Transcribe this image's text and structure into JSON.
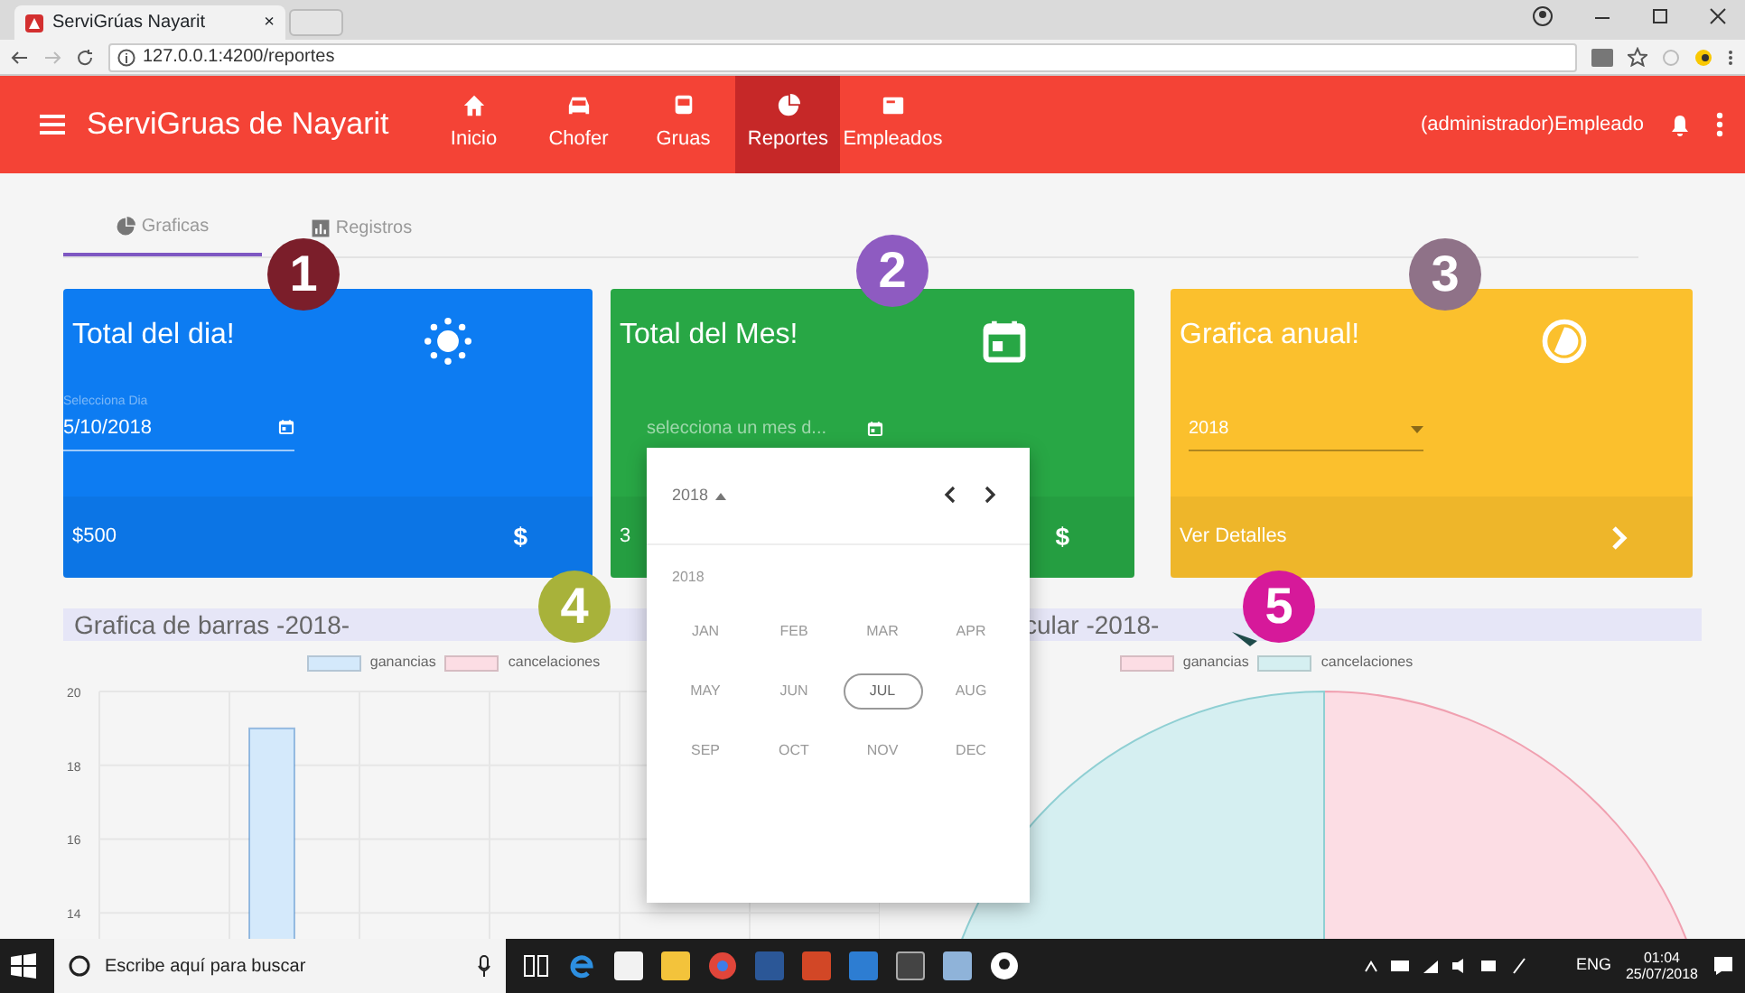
{
  "browser": {
    "tab_title": "ServiGrúas Nayarit",
    "tab_close": "×",
    "url": "127.0.0.1:4200/reportes"
  },
  "navbar": {
    "brand": "ServiGruas de Nayarit",
    "items": [
      {
        "label": "Inicio",
        "selected": false
      },
      {
        "label": "Chofer",
        "selected": false
      },
      {
        "label": "Gruas",
        "selected": false
      },
      {
        "label": "Reportes",
        "selected": true
      },
      {
        "label": "Empleados",
        "selected": false
      }
    ],
    "user": "(administrador)Empleado"
  },
  "tabs": [
    {
      "label": "Graficas",
      "selected": true
    },
    {
      "label": "Registros",
      "selected": false
    }
  ],
  "cards": [
    {
      "kind": "date",
      "color": "#0d7cf2",
      "title": "Total del dia!",
      "field_label": "Selecciona Dia",
      "value": "5/10/2018",
      "footer": "$500",
      "footer_sign": "$"
    },
    {
      "kind": "month",
      "color": "#28a745",
      "title": "Total del Mes!",
      "placeholder": "selecciona un mes d...",
      "footer": "3",
      "footer_sign": "$"
    },
    {
      "kind": "select",
      "color": "#fbc02d",
      "title": "Grafica anual!",
      "value": "2018",
      "footer": "Ver Detalles"
    }
  ],
  "datepicker": {
    "year_button": "2018",
    "year_label": "2018",
    "months": [
      {
        "label": "JAN",
        "selected": false
      },
      {
        "label": "FEB",
        "selected": false
      },
      {
        "label": "MAR",
        "selected": false
      },
      {
        "label": "APR",
        "selected": false
      },
      {
        "label": "MAY",
        "selected": false
      },
      {
        "label": "JUN",
        "selected": false
      },
      {
        "label": "JUL",
        "selected": true
      },
      {
        "label": "AUG",
        "selected": false
      },
      {
        "label": "SEP",
        "selected": false
      },
      {
        "label": "OCT",
        "selected": false
      },
      {
        "label": "NOV",
        "selected": false
      },
      {
        "label": "DEC",
        "selected": false
      }
    ]
  },
  "charts": [
    {
      "title": "Grafica de barras -2018-",
      "chart_data": {
        "type": "bar",
        "ylim": [
          13,
          20
        ],
        "yticks": [
          14,
          16,
          18,
          20
        ],
        "grid": true,
        "series": [
          {
            "name": "ganancias",
            "color": "#d4e9fb",
            "values": [
              null,
              19,
              null,
              null,
              null,
              null
            ]
          },
          {
            "name": "cancelaciones",
            "color": "#fcdde4",
            "values": [
              null,
              null,
              null,
              null,
              null,
              null
            ]
          }
        ]
      }
    },
    {
      "title": "cular -2018-",
      "legend": [
        {
          "name": "ganancias",
          "color": "#fcdde4"
        },
        {
          "name": "cancelaciones",
          "color": "#d5eff1"
        }
      ]
    }
  ],
  "annotations": [
    {
      "label": "1",
      "color": "#7b1e2a",
      "pointer": false
    },
    {
      "label": "2",
      "color": "#8e5bc1",
      "pointer": false
    },
    {
      "label": "3",
      "color": "#8f7288",
      "pointer": false
    },
    {
      "label": "4",
      "color": "#a8b23a",
      "pointer": false
    },
    {
      "label": "5",
      "color": "#d6199a",
      "pointer": true
    }
  ],
  "taskbar": {
    "search_placeholder": "Escribe aquí para buscar",
    "language": "ENG",
    "time": "01:04",
    "date": "25/07/2018"
  }
}
